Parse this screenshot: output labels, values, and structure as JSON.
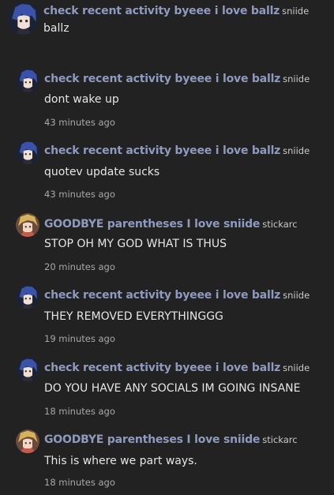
{
  "comments": [
    {
      "display_name": "check recent activity byeee i love ballz",
      "username": "sniide",
      "text": "ballz",
      "time": "",
      "avatar": "blue-hair-avatar"
    },
    {
      "display_name": "check recent activity byeee i love ballz",
      "username": "sniide",
      "text": "dont wake up",
      "time": "43 minutes ago",
      "avatar": "blue-hair-avatar"
    },
    {
      "display_name": "check recent activity byeee i love ballz",
      "username": "sniide",
      "text": "quotev update sucks",
      "time": "43 minutes ago",
      "avatar": "blue-hair-avatar"
    },
    {
      "display_name": "GOODBYE parentheses I love sniide",
      "username": "stickarc",
      "text": "STOP OH MY GOD WHAT IS THUS",
      "time": "20 minutes ago",
      "avatar": "blonde-hair-avatar"
    },
    {
      "display_name": "check recent activity byeee i love ballz",
      "username": "sniide",
      "text": "THEY REMOVED EVERYTHINGGG",
      "time": "19 minutes ago",
      "avatar": "blue-hair-avatar"
    },
    {
      "display_name": "check recent activity byeee i love ballz",
      "username": "sniide",
      "text": "DO YOU HAVE ANY SOCIALS IM GOING INSANE",
      "time": "18 minutes ago",
      "avatar": "blue-hair-avatar"
    },
    {
      "display_name": "GOODBYE parentheses I love sniide",
      "username": "stickarc",
      "text": "This is where we part ways.",
      "time": "18 minutes ago",
      "avatar": "blonde-hair-avatar"
    }
  ]
}
